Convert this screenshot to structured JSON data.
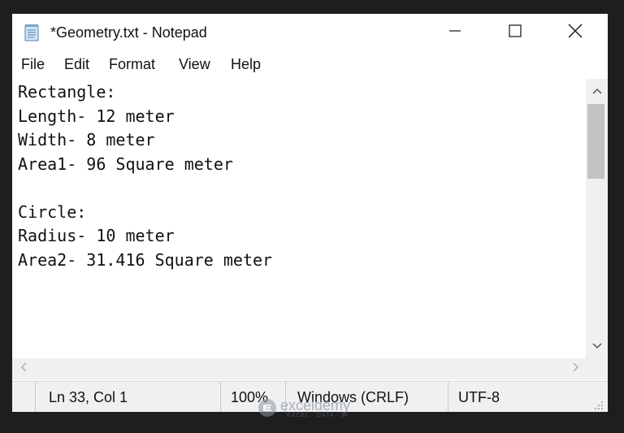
{
  "window": {
    "title": "*Geometry.txt - Notepad",
    "icons": {
      "app": "notepad-icon",
      "minimize": "minimize-icon",
      "maximize": "maximize-icon",
      "close": "close-icon"
    }
  },
  "menu": {
    "items": [
      "File",
      "Edit",
      "Format",
      "View",
      "Help"
    ]
  },
  "editor": {
    "lines": [
      "Rectangle:",
      "Length- 12 meter",
      "Width- 8 meter",
      "Area1- 96 Square meter",
      "",
      "Circle:",
      "Radius- 10 meter",
      "Area2- 31.416 Square meter"
    ]
  },
  "status": {
    "position": "Ln 33, Col 1",
    "zoom": "100%",
    "line_ending": "Windows (CRLF)",
    "encoding": "UTF-8"
  },
  "watermark": {
    "name": "exceldemy",
    "tagline": "EXCEL · DATA · BI"
  }
}
